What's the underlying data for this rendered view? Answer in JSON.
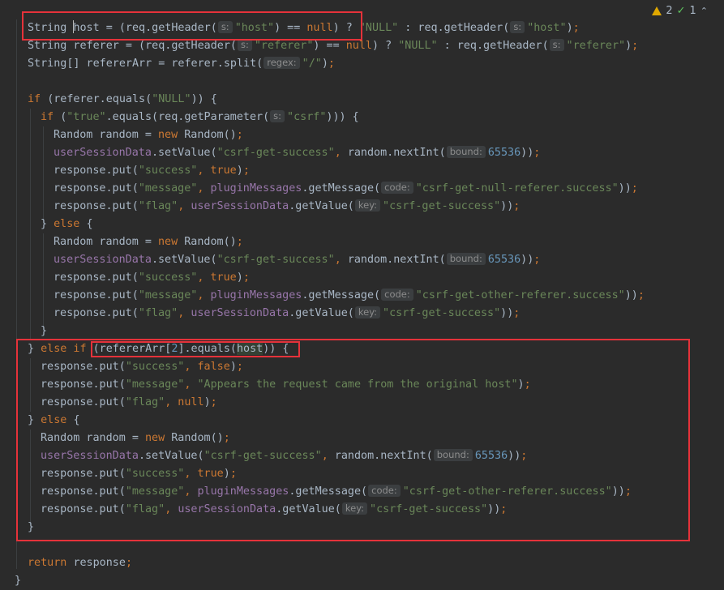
{
  "inspections": {
    "warnings": "2",
    "weak_warnings": "1",
    "warn_color": "#e0a800",
    "ok_color": "#5ec35e"
  },
  "colors": {
    "keyword": "#cc7832",
    "string": "#6a8759",
    "number": "#6897bb",
    "field": "#9876aa",
    "text": "#a9b7c6",
    "highlight_box": "#e5323a",
    "background": "#2b2b2b"
  },
  "code_lines": [
    [
      [
        "id",
        "String "
      ],
      [
        "caret",
        ""
      ],
      [
        "id",
        "host = (req.getHeader("
      ],
      [
        "hint",
        "s:"
      ],
      [
        "str",
        "\"host\""
      ],
      [
        "id",
        ") == "
      ],
      [
        "kw",
        "null"
      ],
      [
        "id",
        ") ? "
      ],
      [
        "str",
        "\"NULL\""
      ],
      [
        "id",
        " : req.getHeader("
      ],
      [
        "hint",
        "s:"
      ],
      [
        "str",
        "\"host\""
      ],
      [
        "id",
        ")"
      ],
      [
        "kw",
        ";"
      ]
    ],
    [
      [
        "id",
        "String referer = (req.getHeader("
      ],
      [
        "hint",
        "s:"
      ],
      [
        "str",
        "\"referer\""
      ],
      [
        "id",
        ") == "
      ],
      [
        "kw",
        "null"
      ],
      [
        "id",
        ") ? "
      ],
      [
        "str",
        "\"NULL\""
      ],
      [
        "id",
        " : req.getHeader("
      ],
      [
        "hint",
        "s:"
      ],
      [
        "str",
        "\"referer\""
      ],
      [
        "id",
        ")"
      ],
      [
        "kw",
        ";"
      ]
    ],
    [
      [
        "id",
        "String[] refererArr = referer.split("
      ],
      [
        "hint",
        "regex:"
      ],
      [
        "str",
        "\"/\""
      ],
      [
        "id",
        ")"
      ],
      [
        "kw",
        ";"
      ]
    ],
    [],
    [
      [
        "kw",
        "if "
      ],
      [
        "id",
        "(referer.equals("
      ],
      [
        "str",
        "\"NULL\""
      ],
      [
        "id",
        ")) {"
      ]
    ],
    [
      [
        "kw",
        "if "
      ],
      [
        "id",
        "("
      ],
      [
        "str",
        "\"true\""
      ],
      [
        "id",
        ".equals(req.getParameter("
      ],
      [
        "hint",
        "s:"
      ],
      [
        "str",
        "\"csrf\""
      ],
      [
        "id",
        "))) {"
      ]
    ],
    [
      [
        "id",
        "Random random = "
      ],
      [
        "kw",
        "new "
      ],
      [
        "id",
        "Random()"
      ],
      [
        "kw",
        ";"
      ]
    ],
    [
      [
        "field",
        "userSessionData"
      ],
      [
        "id",
        ".setValue("
      ],
      [
        "str",
        "\"csrf-get-success\""
      ],
      [
        "kw",
        ", "
      ],
      [
        "id",
        "random.nextInt("
      ],
      [
        "hint",
        "bound:"
      ],
      [
        "num",
        "65536"
      ],
      [
        "id",
        "))"
      ],
      [
        "kw",
        ";"
      ]
    ],
    [
      [
        "id",
        "response.put("
      ],
      [
        "str",
        "\"success\""
      ],
      [
        "kw",
        ", true"
      ],
      [
        "id",
        ")"
      ],
      [
        "kw",
        ";"
      ]
    ],
    [
      [
        "id",
        "response.put("
      ],
      [
        "str",
        "\"message\""
      ],
      [
        "kw",
        ", "
      ],
      [
        "field",
        "pluginMessages"
      ],
      [
        "id",
        ".getMessage("
      ],
      [
        "hint",
        "code:"
      ],
      [
        "str",
        "\"csrf-get-null-referer.success\""
      ],
      [
        "id",
        "))"
      ],
      [
        "kw",
        ";"
      ]
    ],
    [
      [
        "id",
        "response.put("
      ],
      [
        "str",
        "\"flag\""
      ],
      [
        "kw",
        ", "
      ],
      [
        "field",
        "userSessionData"
      ],
      [
        "id",
        ".getValue("
      ],
      [
        "hint",
        "key:"
      ],
      [
        "str",
        "\"csrf-get-success\""
      ],
      [
        "id",
        "))"
      ],
      [
        "kw",
        ";"
      ]
    ],
    [
      [
        "id",
        "} "
      ],
      [
        "kw",
        "else "
      ],
      [
        "id",
        "{"
      ]
    ],
    [
      [
        "id",
        "Random random = "
      ],
      [
        "kw",
        "new "
      ],
      [
        "id",
        "Random()"
      ],
      [
        "kw",
        ";"
      ]
    ],
    [
      [
        "field",
        "userSessionData"
      ],
      [
        "id",
        ".setValue("
      ],
      [
        "str",
        "\"csrf-get-success\""
      ],
      [
        "kw",
        ", "
      ],
      [
        "id",
        "random.nextInt("
      ],
      [
        "hint",
        "bound:"
      ],
      [
        "num",
        "65536"
      ],
      [
        "id",
        "))"
      ],
      [
        "kw",
        ";"
      ]
    ],
    [
      [
        "id",
        "response.put("
      ],
      [
        "str",
        "\"success\""
      ],
      [
        "kw",
        ", true"
      ],
      [
        "id",
        ")"
      ],
      [
        "kw",
        ";"
      ]
    ],
    [
      [
        "id",
        "response.put("
      ],
      [
        "str",
        "\"message\""
      ],
      [
        "kw",
        ", "
      ],
      [
        "field",
        "pluginMessages"
      ],
      [
        "id",
        ".getMessage("
      ],
      [
        "hint",
        "code:"
      ],
      [
        "str",
        "\"csrf-get-other-referer.success\""
      ],
      [
        "id",
        "))"
      ],
      [
        "kw",
        ";"
      ]
    ],
    [
      [
        "id",
        "response.put("
      ],
      [
        "str",
        "\"flag\""
      ],
      [
        "kw",
        ", "
      ],
      [
        "field",
        "userSessionData"
      ],
      [
        "id",
        ".getValue("
      ],
      [
        "hint",
        "key:"
      ],
      [
        "str",
        "\"csrf-get-success\""
      ],
      [
        "id",
        "))"
      ],
      [
        "kw",
        ";"
      ]
    ],
    [
      [
        "id",
        "}"
      ]
    ],
    [
      [
        "id",
        "} "
      ],
      [
        "kw",
        "else if "
      ],
      [
        "id",
        "(refererArr["
      ],
      [
        "num",
        "2"
      ],
      [
        "id",
        "].equals("
      ],
      [
        "match",
        "host"
      ],
      [
        "id",
        ")) {"
      ]
    ],
    [
      [
        "id",
        "response.put("
      ],
      [
        "str",
        "\"success\""
      ],
      [
        "kw",
        ", false"
      ],
      [
        "id",
        ")"
      ],
      [
        "kw",
        ";"
      ]
    ],
    [
      [
        "id",
        "response.put("
      ],
      [
        "str",
        "\"message\""
      ],
      [
        "kw",
        ", "
      ],
      [
        "str",
        "\"Appears the request came from the original host\""
      ],
      [
        "id",
        ")"
      ],
      [
        "kw",
        ";"
      ]
    ],
    [
      [
        "id",
        "response.put("
      ],
      [
        "str",
        "\"flag\""
      ],
      [
        "kw",
        ", null"
      ],
      [
        "id",
        ")"
      ],
      [
        "kw",
        ";"
      ]
    ],
    [
      [
        "id",
        "} "
      ],
      [
        "kw",
        "else "
      ],
      [
        "id",
        "{"
      ]
    ],
    [
      [
        "id",
        "Random random = "
      ],
      [
        "kw",
        "new "
      ],
      [
        "id",
        "Random()"
      ],
      [
        "kw",
        ";"
      ]
    ],
    [
      [
        "field",
        "userSessionData"
      ],
      [
        "id",
        ".setValue("
      ],
      [
        "str",
        "\"csrf-get-success\""
      ],
      [
        "kw",
        ", "
      ],
      [
        "id",
        "random.nextInt("
      ],
      [
        "hint",
        "bound:"
      ],
      [
        "num",
        "65536"
      ],
      [
        "id",
        "))"
      ],
      [
        "kw",
        ";"
      ]
    ],
    [
      [
        "id",
        "response.put("
      ],
      [
        "str",
        "\"success\""
      ],
      [
        "kw",
        ", true"
      ],
      [
        "id",
        ")"
      ],
      [
        "kw",
        ";"
      ]
    ],
    [
      [
        "id",
        "response.put("
      ],
      [
        "str",
        "\"message\""
      ],
      [
        "kw",
        ", "
      ],
      [
        "field",
        "pluginMessages"
      ],
      [
        "id",
        ".getMessage("
      ],
      [
        "hint",
        "code:"
      ],
      [
        "str",
        "\"csrf-get-other-referer.success\""
      ],
      [
        "id",
        "))"
      ],
      [
        "kw",
        ";"
      ]
    ],
    [
      [
        "id",
        "response.put("
      ],
      [
        "str",
        "\"flag\""
      ],
      [
        "kw",
        ", "
      ],
      [
        "field",
        "userSessionData"
      ],
      [
        "id",
        ".getValue("
      ],
      [
        "hint",
        "key:"
      ],
      [
        "str",
        "\"csrf-get-success\""
      ],
      [
        "id",
        "))"
      ],
      [
        "kw",
        ";"
      ]
    ],
    [
      [
        "id",
        "}"
      ]
    ],
    [],
    [
      [
        "kw",
        "return "
      ],
      [
        "id",
        "response"
      ],
      [
        "kw",
        ";"
      ]
    ],
    [
      [
        "id",
        "}"
      ]
    ]
  ]
}
